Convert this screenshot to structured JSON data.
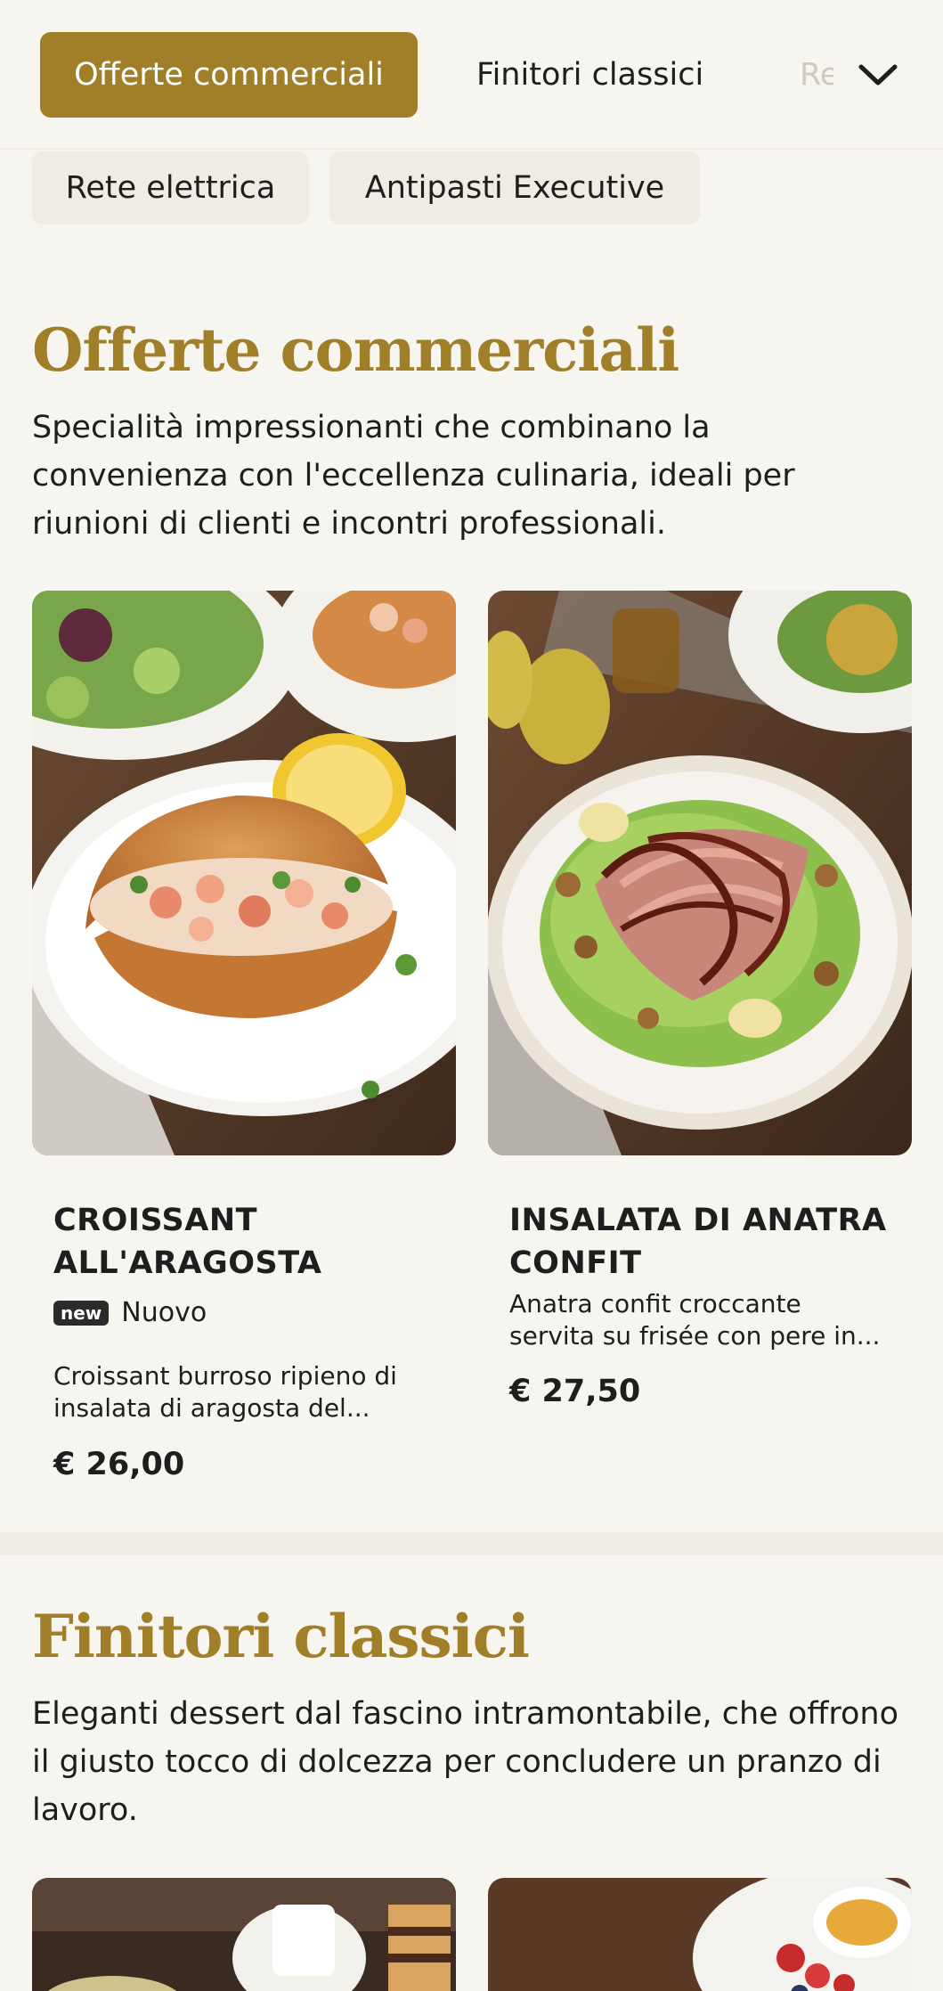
{
  "nav": {
    "tabs": [
      {
        "label": "Offerte commerciali",
        "active": true
      },
      {
        "label": "Finitori classici",
        "active": false
      },
      {
        "label": "Rete elettrica",
        "active": false
      }
    ],
    "secondary_tabs": [
      {
        "label": "Rete elettrica"
      },
      {
        "label": "Antipasti Executive"
      }
    ],
    "more_icon": "chevron-down-icon"
  },
  "sections": [
    {
      "title": "Offerte commerciali",
      "description": "Specialità impressionanti che combinano la convenienza con l'eccellenza culinaria, ideali per riunioni di clienti e incontri professionali.",
      "items": [
        {
          "title": "CROISSANT ALL'ARAGOSTA",
          "badge": "new",
          "badge_text": "Nuovo",
          "description": "Croissant burroso ripieno di insalata di aragosta del...",
          "price": "€ 26,00"
        },
        {
          "title": "INSALATA DI ANATRA CONFIT",
          "description": "Anatra confit croccante servita su frisée con pere in...",
          "price": "€ 27,50"
        }
      ]
    },
    {
      "title": "Finitori classici",
      "description": "Eleganti dessert dal fascino intramontabile, che offrono il giusto tocco di dolcezza per concludere un pranzo di lavoro."
    }
  ],
  "colors": {
    "accent": "#a17f28",
    "background": "#f7f5f0",
    "pill": "#efece3",
    "text": "#1e1e1e"
  }
}
